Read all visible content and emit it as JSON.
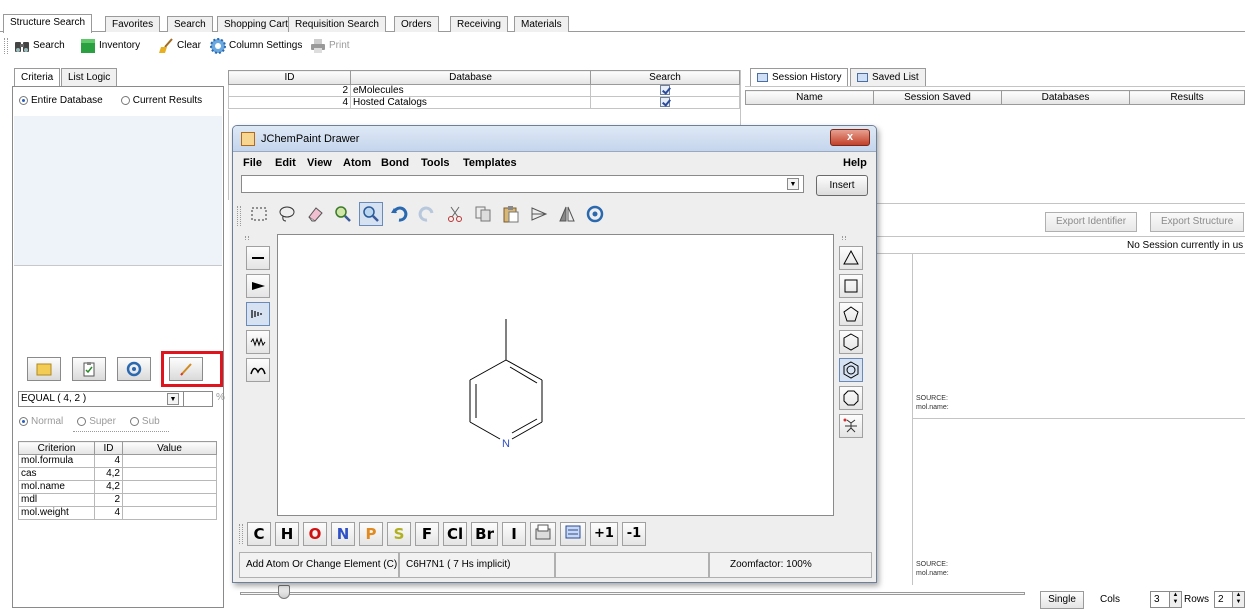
{
  "top_tabs": [
    "Structure Search",
    "Favorites",
    "Search",
    "Shopping Cart",
    "Requisition Search",
    "Orders",
    "Receiving",
    "Materials"
  ],
  "toolbar": {
    "search": "Search",
    "inventory": "Inventory",
    "clear": "Clear",
    "column_settings": "Column Settings",
    "print": "Print"
  },
  "left_panel": {
    "tabs": [
      "Criteria",
      "List Logic"
    ],
    "scope_options": [
      "Entire Database",
      "Current Results"
    ],
    "operator": "EQUAL ( 4, 2 )",
    "percent_unit": "%",
    "mode_options": [
      "Normal",
      "Super",
      "Sub"
    ],
    "criteria_table": {
      "headers": [
        "Criterion",
        "ID",
        "Value"
      ],
      "rows": [
        [
          "mol.formula",
          "4",
          ""
        ],
        [
          "cas",
          "4,2",
          ""
        ],
        [
          "mol.name",
          "4,2",
          ""
        ],
        [
          "mdl",
          "2",
          ""
        ],
        [
          "mol.weight",
          "4",
          ""
        ]
      ]
    }
  },
  "database_table": {
    "headers": [
      "ID",
      "Database",
      "Search"
    ],
    "rows": [
      [
        "2",
        "eMolecules",
        true
      ],
      [
        "4",
        "Hosted Catalogs",
        true
      ]
    ]
  },
  "right_panel": {
    "tabs": [
      "Session History",
      "Saved List"
    ],
    "session_headers": [
      "Name",
      "Session Saved",
      "Databases",
      "Results"
    ],
    "export_identifier": "Export Identifier",
    "export_structure": "Export Structure",
    "no_session": "No Session currently in us",
    "source_label": "SOURCE:",
    "mol_name_label": "mol.name:",
    "single": "Single",
    "cols_label": "Cols",
    "cols_value": "3",
    "rows_label": "Rows",
    "rows_value": "2"
  },
  "jchempaint": {
    "title": "JChemPaint Drawer",
    "close": "x",
    "menu": [
      "File",
      "Edit",
      "View",
      "Atom",
      "Bond",
      "Tools",
      "Templates"
    ],
    "help": "Help",
    "insert": "Insert",
    "molecule_atom_label": "N",
    "elements": [
      "C",
      "H",
      "O",
      "N",
      "P",
      "S",
      "F",
      "Cl",
      "Br",
      "I"
    ],
    "charges": [
      "+1",
      "-1"
    ],
    "element_colors": {
      "C": "#000000",
      "H": "#000000",
      "O": "#d01010",
      "N": "#3050c8",
      "P": "#e08a20",
      "S": "#b0b020",
      "F": "#000000",
      "Cl": "#000000",
      "Br": "#000000",
      "I": "#000000"
    },
    "status": {
      "hint": "Add Atom Or Change Element (C)",
      "formula": "C6H7N1 ( 7 Hs implicit)",
      "zoom": "Zoomfactor: 100%"
    }
  }
}
